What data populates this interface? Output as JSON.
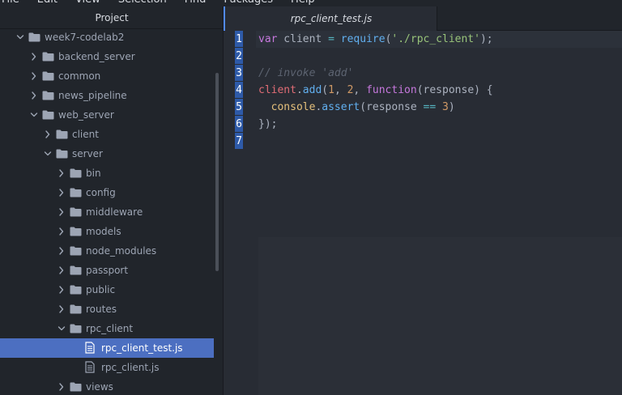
{
  "menu": [
    "File",
    "Edit",
    "View",
    "Selection",
    "Find",
    "Packages",
    "Help"
  ],
  "tree": {
    "header": "Project",
    "items": [
      {
        "label": "week7-codelab2",
        "type": "folder",
        "open": true,
        "depth": 0
      },
      {
        "label": "backend_server",
        "type": "folder",
        "open": false,
        "depth": 1
      },
      {
        "label": "common",
        "type": "folder",
        "open": false,
        "depth": 1
      },
      {
        "label": "news_pipeline",
        "type": "folder",
        "open": false,
        "depth": 1
      },
      {
        "label": "web_server",
        "type": "folder",
        "open": true,
        "depth": 1
      },
      {
        "label": "client",
        "type": "folder",
        "open": false,
        "depth": 2
      },
      {
        "label": "server",
        "type": "folder",
        "open": true,
        "depth": 2
      },
      {
        "label": "bin",
        "type": "folder",
        "open": false,
        "depth": 3
      },
      {
        "label": "config",
        "type": "folder",
        "open": false,
        "depth": 3
      },
      {
        "label": "middleware",
        "type": "folder",
        "open": false,
        "depth": 3
      },
      {
        "label": "models",
        "type": "folder",
        "open": false,
        "depth": 3
      },
      {
        "label": "node_modules",
        "type": "folder",
        "open": false,
        "depth": 3
      },
      {
        "label": "passport",
        "type": "folder",
        "open": false,
        "depth": 3
      },
      {
        "label": "public",
        "type": "folder",
        "open": false,
        "depth": 3
      },
      {
        "label": "routes",
        "type": "folder",
        "open": false,
        "depth": 3
      },
      {
        "label": "rpc_client",
        "type": "folder",
        "open": true,
        "depth": 3
      },
      {
        "label": "rpc_client_test.js",
        "type": "file",
        "depth": 4,
        "selected": true
      },
      {
        "label": "rpc_client.js",
        "type": "file",
        "depth": 4
      },
      {
        "label": "views",
        "type": "folder",
        "open": false,
        "depth": 3
      }
    ]
  },
  "tab": {
    "title": "rpc_client_test.js"
  },
  "editor": {
    "line_numbers": [
      "1",
      "2",
      "3",
      "4",
      "5",
      "6",
      "7"
    ],
    "lines": [
      [
        {
          "t": "var",
          "c": "kw"
        },
        {
          "t": " client "
        },
        {
          "t": "=",
          "c": "op"
        },
        {
          "t": " "
        },
        {
          "t": "require",
          "c": "fn"
        },
        {
          "t": "("
        },
        {
          "t": "'./rpc_client'",
          "c": "str"
        },
        {
          "t": ");"
        }
      ],
      [],
      [
        {
          "t": "// invoke 'add'",
          "c": "cmt"
        }
      ],
      [
        {
          "t": "client",
          "c": "var"
        },
        {
          "t": "."
        },
        {
          "t": "add",
          "c": "fn"
        },
        {
          "t": "("
        },
        {
          "t": "1",
          "c": "num"
        },
        {
          "t": ", "
        },
        {
          "t": "2",
          "c": "num"
        },
        {
          "t": ", "
        },
        {
          "t": "function",
          "c": "kw"
        },
        {
          "t": "(response) {"
        }
      ],
      [
        {
          "t": "  "
        },
        {
          "t": "console",
          "c": "obj"
        },
        {
          "t": "."
        },
        {
          "t": "assert",
          "c": "fn"
        },
        {
          "t": "(response "
        },
        {
          "t": "==",
          "c": "op"
        },
        {
          "t": " "
        },
        {
          "t": "3",
          "c": "num"
        },
        {
          "t": ")"
        }
      ],
      [
        {
          "t": "});"
        }
      ],
      []
    ]
  },
  "colors": {
    "accent": "#528bff",
    "selection": "#4c6fc1",
    "panel_bg": "#21252b",
    "editor_bg": "#282c34"
  },
  "icons": {
    "chevron_open": "chevron-down-icon",
    "chevron_closed": "chevron-right-icon",
    "folder": "folder-icon",
    "file": "file-text-icon"
  }
}
